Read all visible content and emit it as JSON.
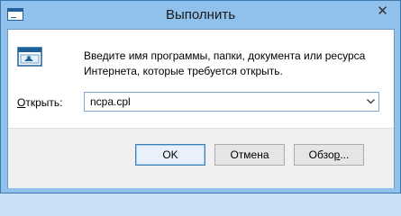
{
  "window": {
    "title": "Выполнить",
    "close_glyph": "✕"
  },
  "dialog": {
    "description": "Введите имя программы, папки, документа или ресурса Интернета, которые требуется открыть.",
    "open_label_mnemonic": "О",
    "open_label_rest": "ткрыть:",
    "command_value": "ncpa.cpl"
  },
  "buttons": {
    "ok": "OK",
    "cancel": "Отмена",
    "browse_pre": "Обзо",
    "browse_mnemonic": "р",
    "browse_post": "..."
  },
  "icons": {
    "app": "run-window-icon",
    "run": "run-program-icon",
    "close": "close-icon",
    "dropdown": "chevron-down-icon"
  },
  "colors": {
    "title_bar": "#8fc1ec",
    "accent": "#3b78ad",
    "footer": "#f0f0f0"
  }
}
